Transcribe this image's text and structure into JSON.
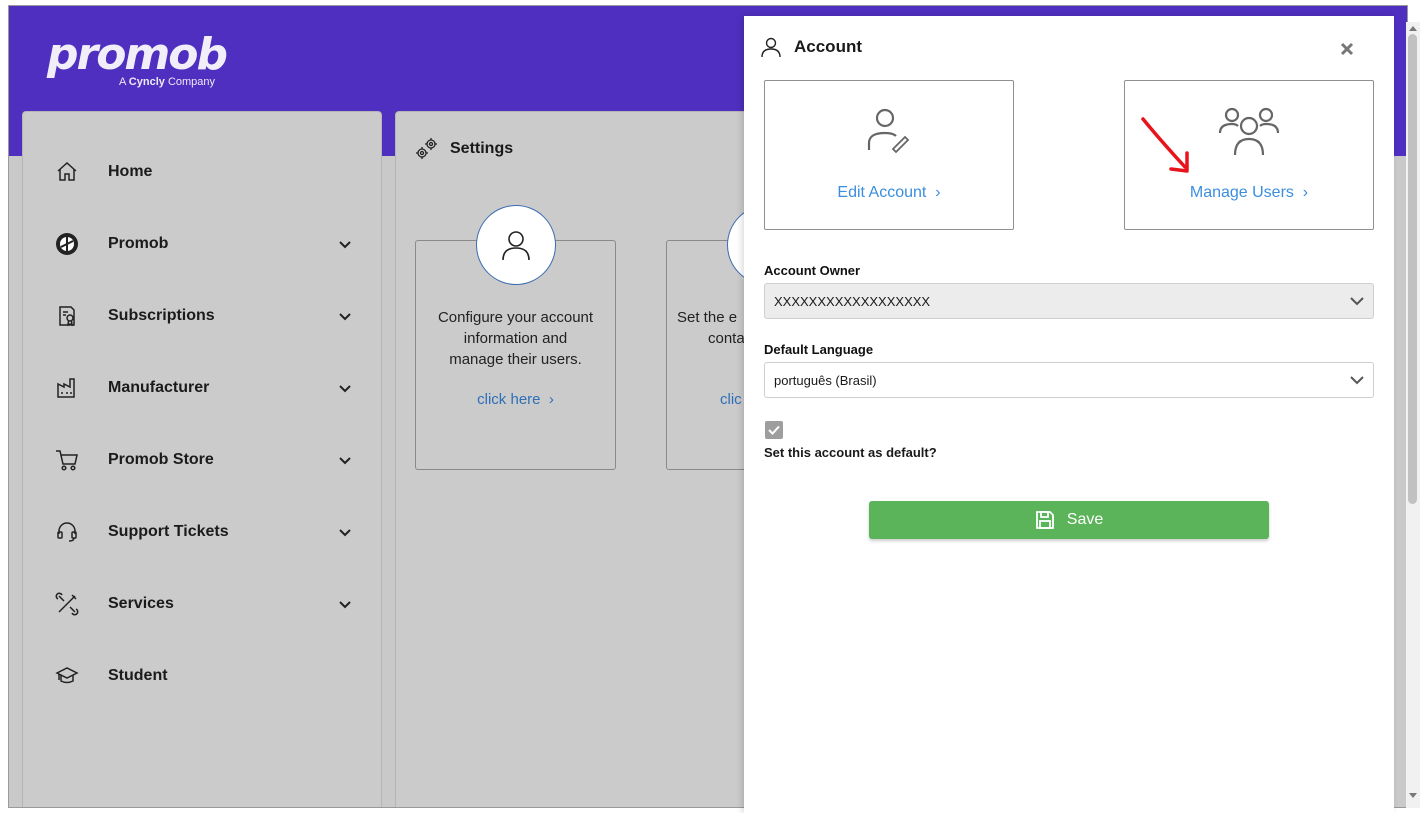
{
  "brand": {
    "logo_text": "promob",
    "tagline_prefix": "A",
    "tagline_brand": "Cyncly",
    "tagline_suffix": "Company"
  },
  "sidebar": {
    "items": [
      {
        "label": "Home",
        "icon": "home-icon",
        "expandable": false
      },
      {
        "label": "Promob",
        "icon": "promob-logo-icon",
        "expandable": true
      },
      {
        "label": "Subscriptions",
        "icon": "certificate-icon",
        "expandable": true
      },
      {
        "label": "Manufacturer",
        "icon": "factory-icon",
        "expandable": true
      },
      {
        "label": "Promob Store",
        "icon": "cart-icon",
        "expandable": true
      },
      {
        "label": "Support Tickets",
        "icon": "headset-icon",
        "expandable": true
      },
      {
        "label": "Services",
        "icon": "tools-icon",
        "expandable": true
      },
      {
        "label": "Student",
        "icon": "graduation-cap-icon",
        "expandable": false
      }
    ]
  },
  "settings": {
    "title": "Settings",
    "cards": [
      {
        "text_lines": [
          "Configure your account",
          "information and",
          "manage their users."
        ],
        "link": "click here"
      },
      {
        "text_lines": [
          "Set the e",
          "conta"
        ],
        "link": "clic"
      }
    ]
  },
  "account_panel": {
    "title": "Account",
    "edit_account": "Edit Account",
    "manage_users": "Manage Users",
    "owner_label": "Account Owner",
    "owner_value": "XXXXXXXXXXXXXXXXXX",
    "language_label": "Default Language",
    "language_value": "português (Brasil)",
    "default_label": "Set this account as default?",
    "default_checked": true,
    "save_label": "Save"
  },
  "colors": {
    "header": "#4f2fbf",
    "link": "#3b8ede",
    "save": "#5bb35a",
    "annotation_arrow": "#e8141b"
  }
}
